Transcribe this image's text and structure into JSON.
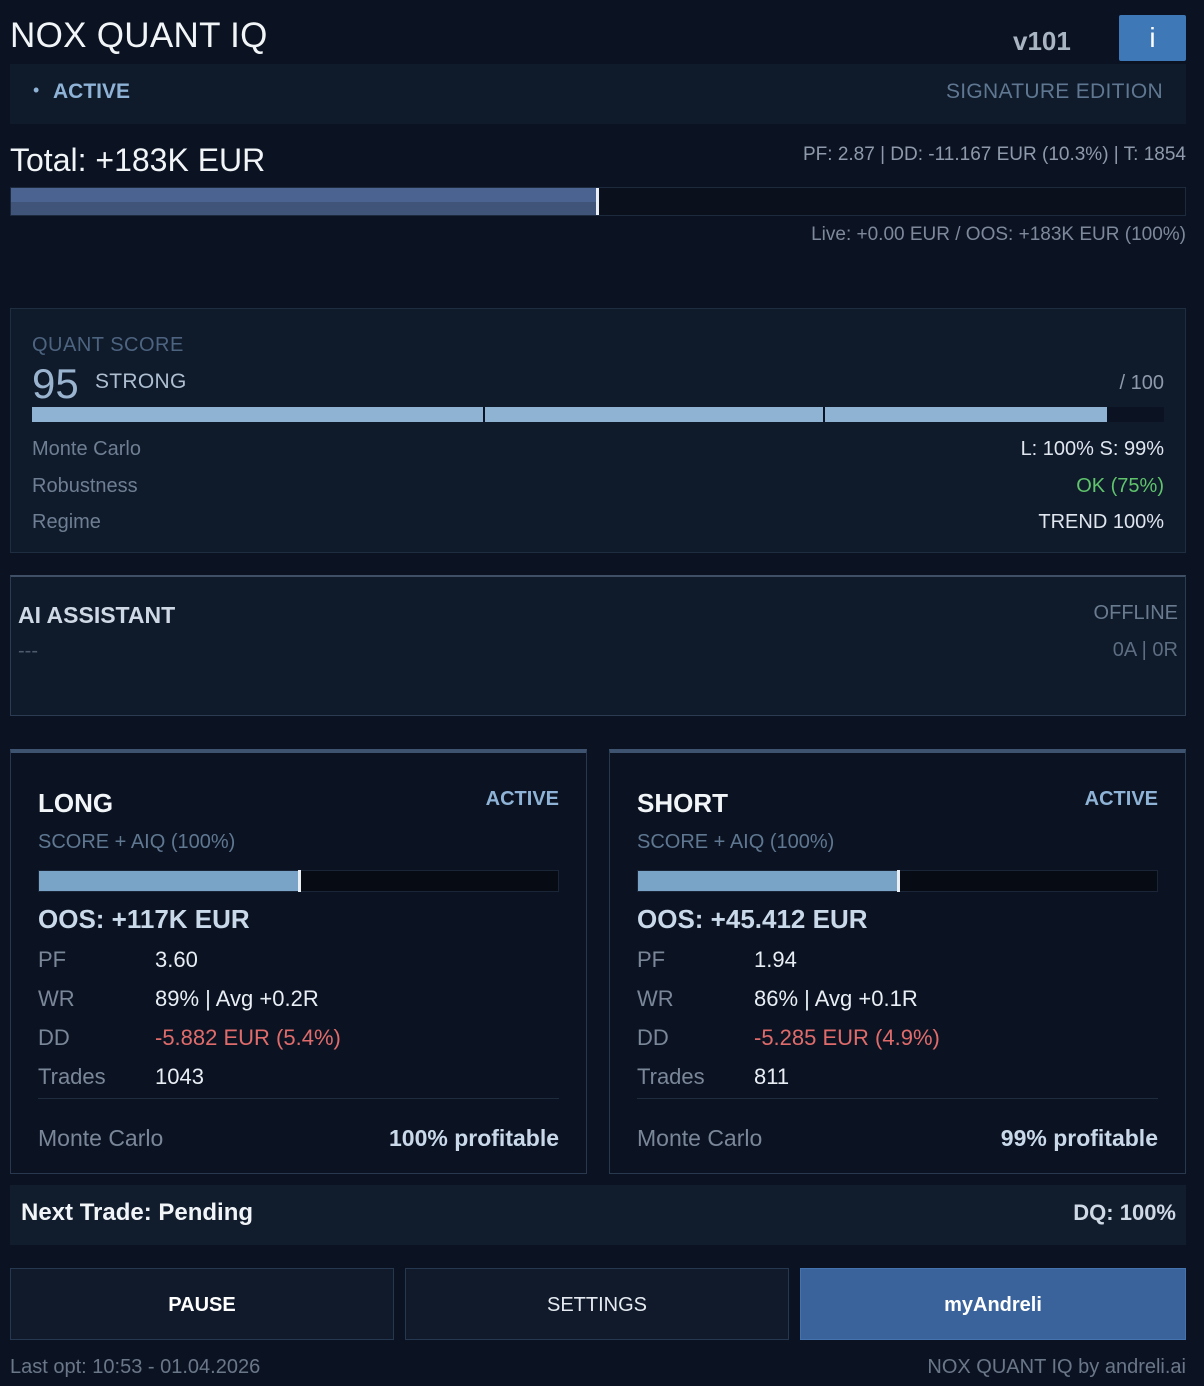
{
  "header": {
    "title": "NOX QUANT IQ",
    "version": "v101",
    "info_label": "i",
    "status_dot": "•",
    "status": "ACTIVE",
    "edition": "SIGNATURE EDITION"
  },
  "total": {
    "label": "Total: +183K EUR",
    "stats": "PF: 2.87 | DD: -11.167 EUR (10.3%) | T: 1854",
    "progress": 0.5,
    "live": "Live: +0.00 EUR / OOS: +183K EUR (100%)"
  },
  "quant": {
    "title": "QUANT SCORE",
    "score": "95",
    "grade": "STRONG",
    "max": "/ 100",
    "score_fraction": 0.95,
    "metrics": [
      {
        "label": "Monte Carlo",
        "value": "L: 100%   S: 99%",
        "color": "#dfe6ef"
      },
      {
        "label": "Robustness",
        "value": "OK (75%)",
        "color": "#5fc46c"
      },
      {
        "label": "Regime",
        "value": "TREND 100%",
        "color": "#dfe6ef"
      }
    ]
  },
  "ai": {
    "title": "AI ASSISTANT",
    "status": "OFFLINE",
    "text": "---",
    "counts": "0A | 0R"
  },
  "long": {
    "title": "LONG",
    "state": "ACTIVE",
    "subtitle": "SCORE + AIQ (100%)",
    "progress": 0.5,
    "oos": "OOS: +117K EUR",
    "rows": [
      {
        "label": "PF",
        "value": "3.60"
      },
      {
        "label": "WR",
        "value": "89% | Avg +0.2R"
      },
      {
        "label": "DD",
        "value": "-5.882 EUR (5.4%)"
      },
      {
        "label": "Trades",
        "value": "1043"
      }
    ],
    "mc_label": "Monte Carlo",
    "mc_value": "100% profitable"
  },
  "short": {
    "title": "SHORT",
    "state": "ACTIVE",
    "subtitle": "SCORE + AIQ (100%)",
    "progress": 0.5,
    "oos": "OOS: +45.412 EUR",
    "rows": [
      {
        "label": "PF",
        "value": "1.94"
      },
      {
        "label": "WR",
        "value": "86% | Avg +0.1R"
      },
      {
        "label": "DD",
        "value": "-5.285 EUR (4.9%)"
      },
      {
        "label": "Trades",
        "value": "811"
      }
    ],
    "mc_label": "Monte Carlo",
    "mc_value": "99% profitable"
  },
  "next": {
    "trade": "Next Trade: Pending",
    "dq": "DQ: 100%"
  },
  "buttons": {
    "pause": "PAUSE",
    "settings": "SETTINGS",
    "my": "myAndreli"
  },
  "footer": {
    "last_opt": "Last opt: 10:53 - 01.04.2026",
    "brand": "NOX QUANT IQ by andreli.ai"
  },
  "colors": {
    "background": "#0b1322",
    "accent": "#3e78b7",
    "negative": "#e06b6b",
    "positive": "#5fc46c"
  }
}
